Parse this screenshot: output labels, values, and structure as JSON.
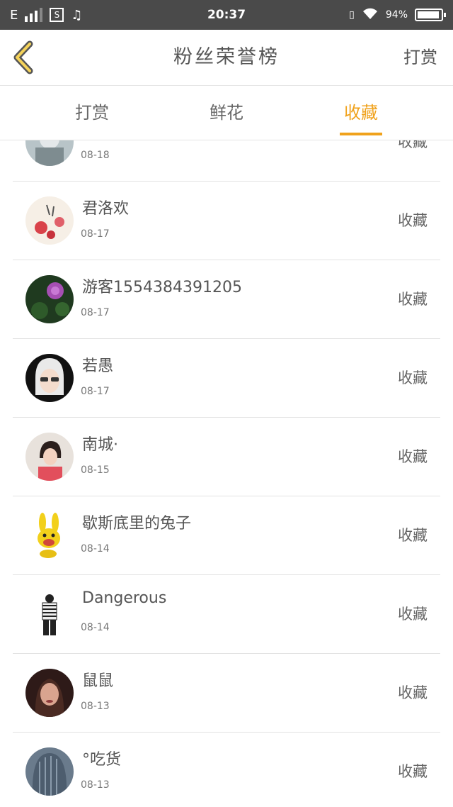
{
  "status_bar": {
    "network": "E",
    "sim_icon_label": "S",
    "time": "20:37",
    "battery": "94%",
    "battery_level": 0.94
  },
  "header": {
    "title": "粉丝荣誉榜",
    "right_action": "打赏",
    "back_icon": "chevron-left-icon",
    "accent_color": "#f0a21c"
  },
  "tabs": [
    {
      "label": "打赏",
      "active": false
    },
    {
      "label": "鲜花",
      "active": false
    },
    {
      "label": "收藏",
      "active": true
    }
  ],
  "list": [
    {
      "name": "",
      "date": "08-18",
      "action": "收藏"
    },
    {
      "name": "君洛欢",
      "date": "08-17",
      "action": "收藏"
    },
    {
      "name": "游客1554384391205",
      "date": "08-17",
      "action": "收藏"
    },
    {
      "name": "若愚",
      "date": "08-17",
      "action": "收藏"
    },
    {
      "name": "南城·",
      "date": "08-15",
      "action": "收藏"
    },
    {
      "name": "歇斯底里的兔子",
      "date": "08-14",
      "action": "收藏"
    },
    {
      "name": "Dangerous",
      "date": "08-14",
      "action": "收藏"
    },
    {
      "name": "鼠鼠",
      "date": "08-13",
      "action": "收藏"
    },
    {
      "name": "°吃货",
      "date": "08-13",
      "action": "收藏"
    }
  ]
}
